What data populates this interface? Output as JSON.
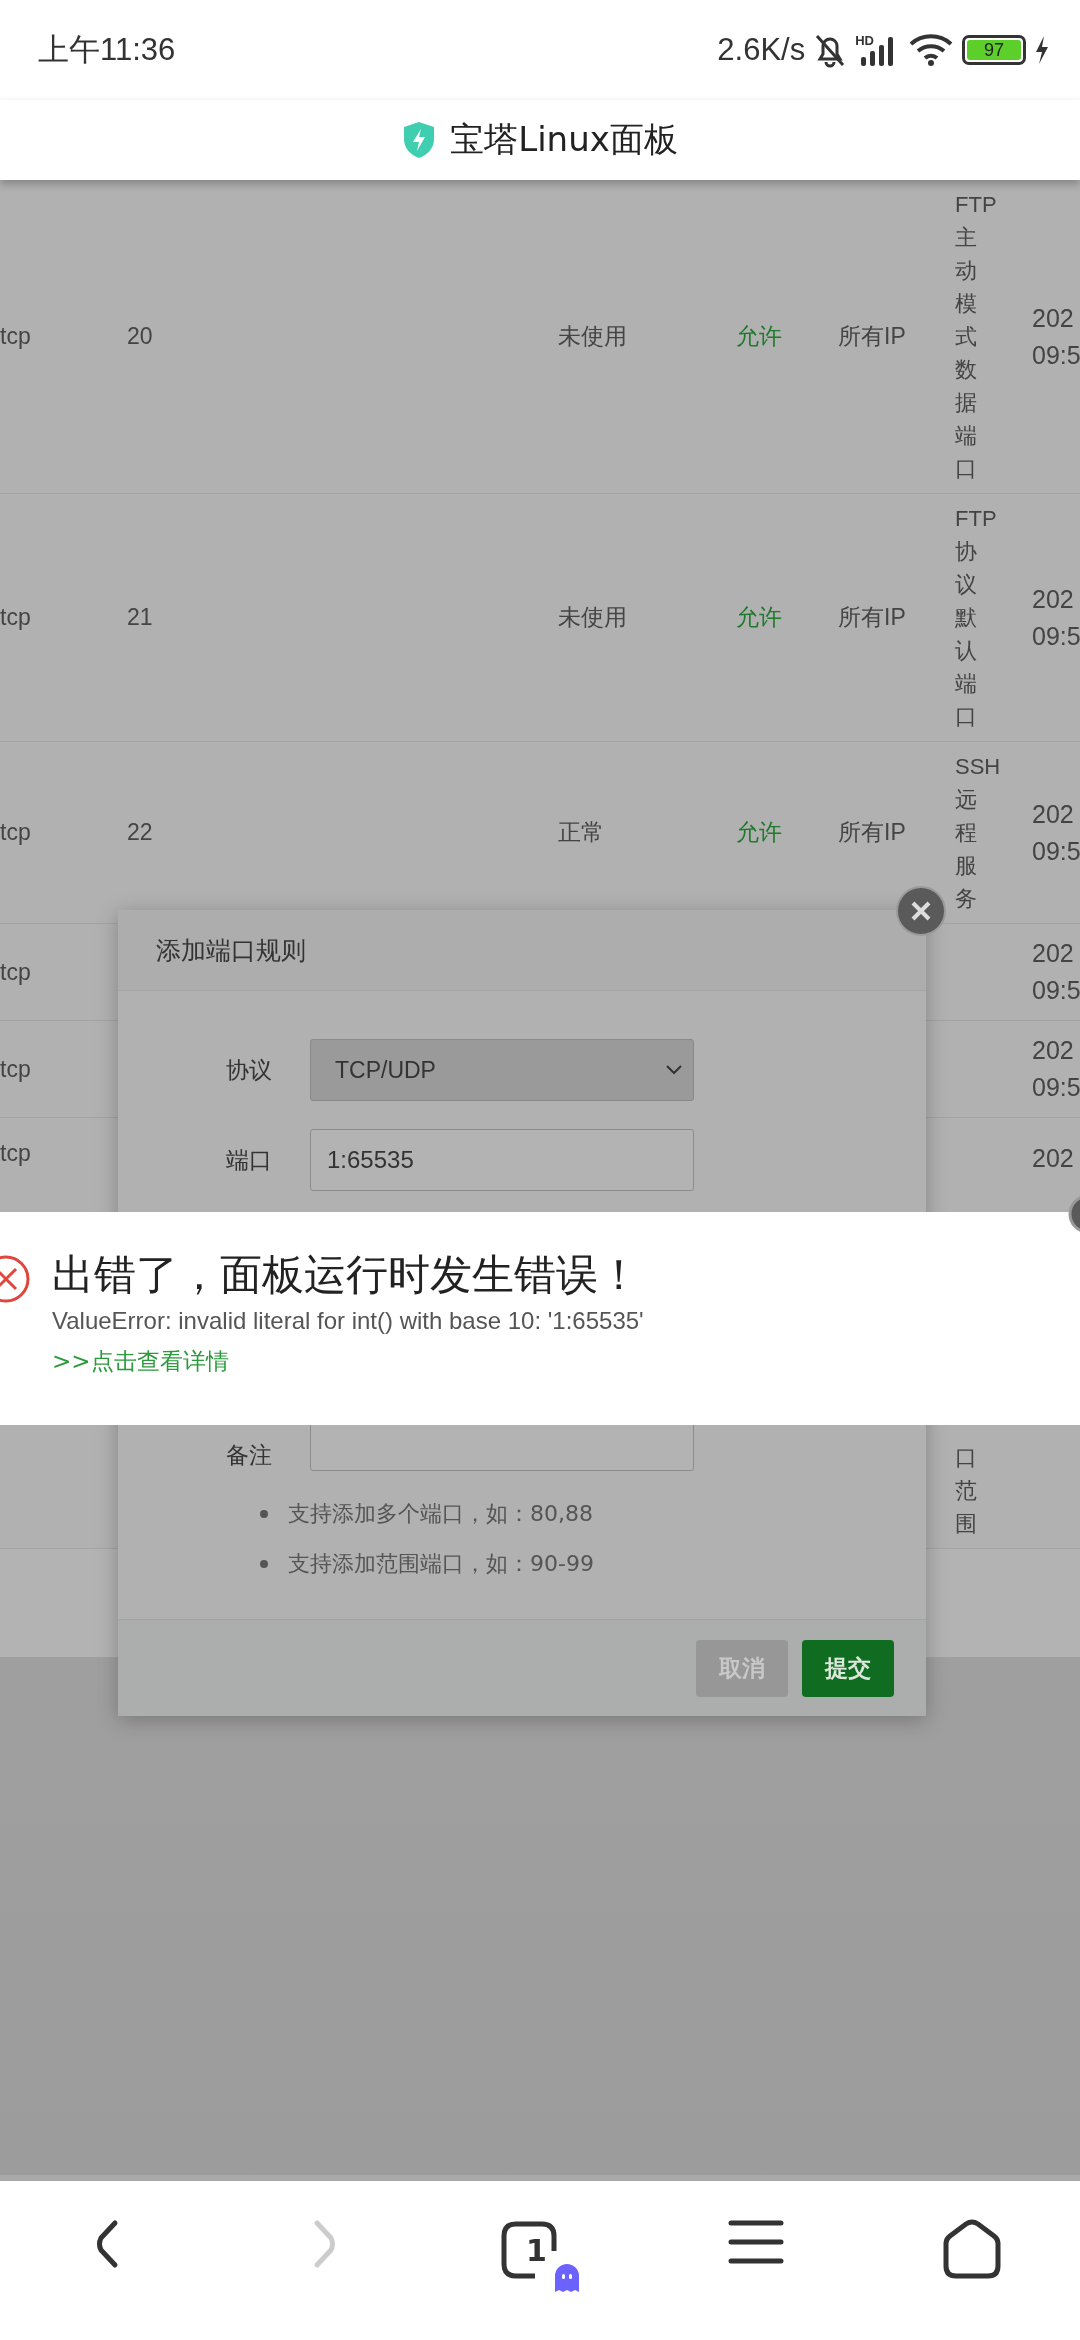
{
  "status_bar": {
    "time": "上午11:36",
    "net_speed": "2.6K/s",
    "network_badge": "HD",
    "battery": "97",
    "charging": true
  },
  "header": {
    "title": "宝塔Linux面板"
  },
  "table": {
    "rows": [
      {
        "protocol": "tcp",
        "port": "20",
        "status": "未使用",
        "policy": "允许",
        "source": "所有IP",
        "note": "FTP主动模式数据端口",
        "date": "202",
        "time": "09:5"
      },
      {
        "protocol": "tcp",
        "port": "21",
        "status": "未使用",
        "policy": "允许",
        "source": "所有IP",
        "note": "FTP协议默认端口",
        "date": "202",
        "time": "09:5"
      },
      {
        "protocol": "tcp",
        "port": "22",
        "status": "正常",
        "policy": "允许",
        "source": "所有IP",
        "note": "SSH远程服务",
        "date": "202",
        "time": "09:5"
      },
      {
        "protocol": "tcp",
        "date": "202",
        "time": "09:5"
      },
      {
        "protocol": "tcp",
        "date": "202",
        "time": "09:5"
      },
      {
        "protocol": "tcp",
        "note": "口范围",
        "date": "202"
      }
    ]
  },
  "dialog": {
    "title": "添加端口规则",
    "fields": [
      {
        "kind": "select",
        "label": "协议",
        "value": "TCP/UDP"
      },
      {
        "kind": "input",
        "label": "端口",
        "value": "1:65535"
      },
      {
        "kind": "input",
        "label": "备注"
      }
    ],
    "tips": [
      "支持添加多个端口，如：80,88",
      "支持添加范围端口，如：90-99"
    ],
    "buttons": [
      {
        "label": "取消",
        "kind": "secondary"
      },
      {
        "label": "提交",
        "kind": "primary"
      }
    ]
  },
  "error_toast": {
    "title": "出错了，面板运行时发生错误！",
    "message": "ValueError: invalid literal for int() with base 10: '1:65535'",
    "link": ">>点击查看详情"
  },
  "bottom_nav": {
    "back_disabled": false,
    "forward_disabled": true,
    "tab_count": "1"
  }
}
